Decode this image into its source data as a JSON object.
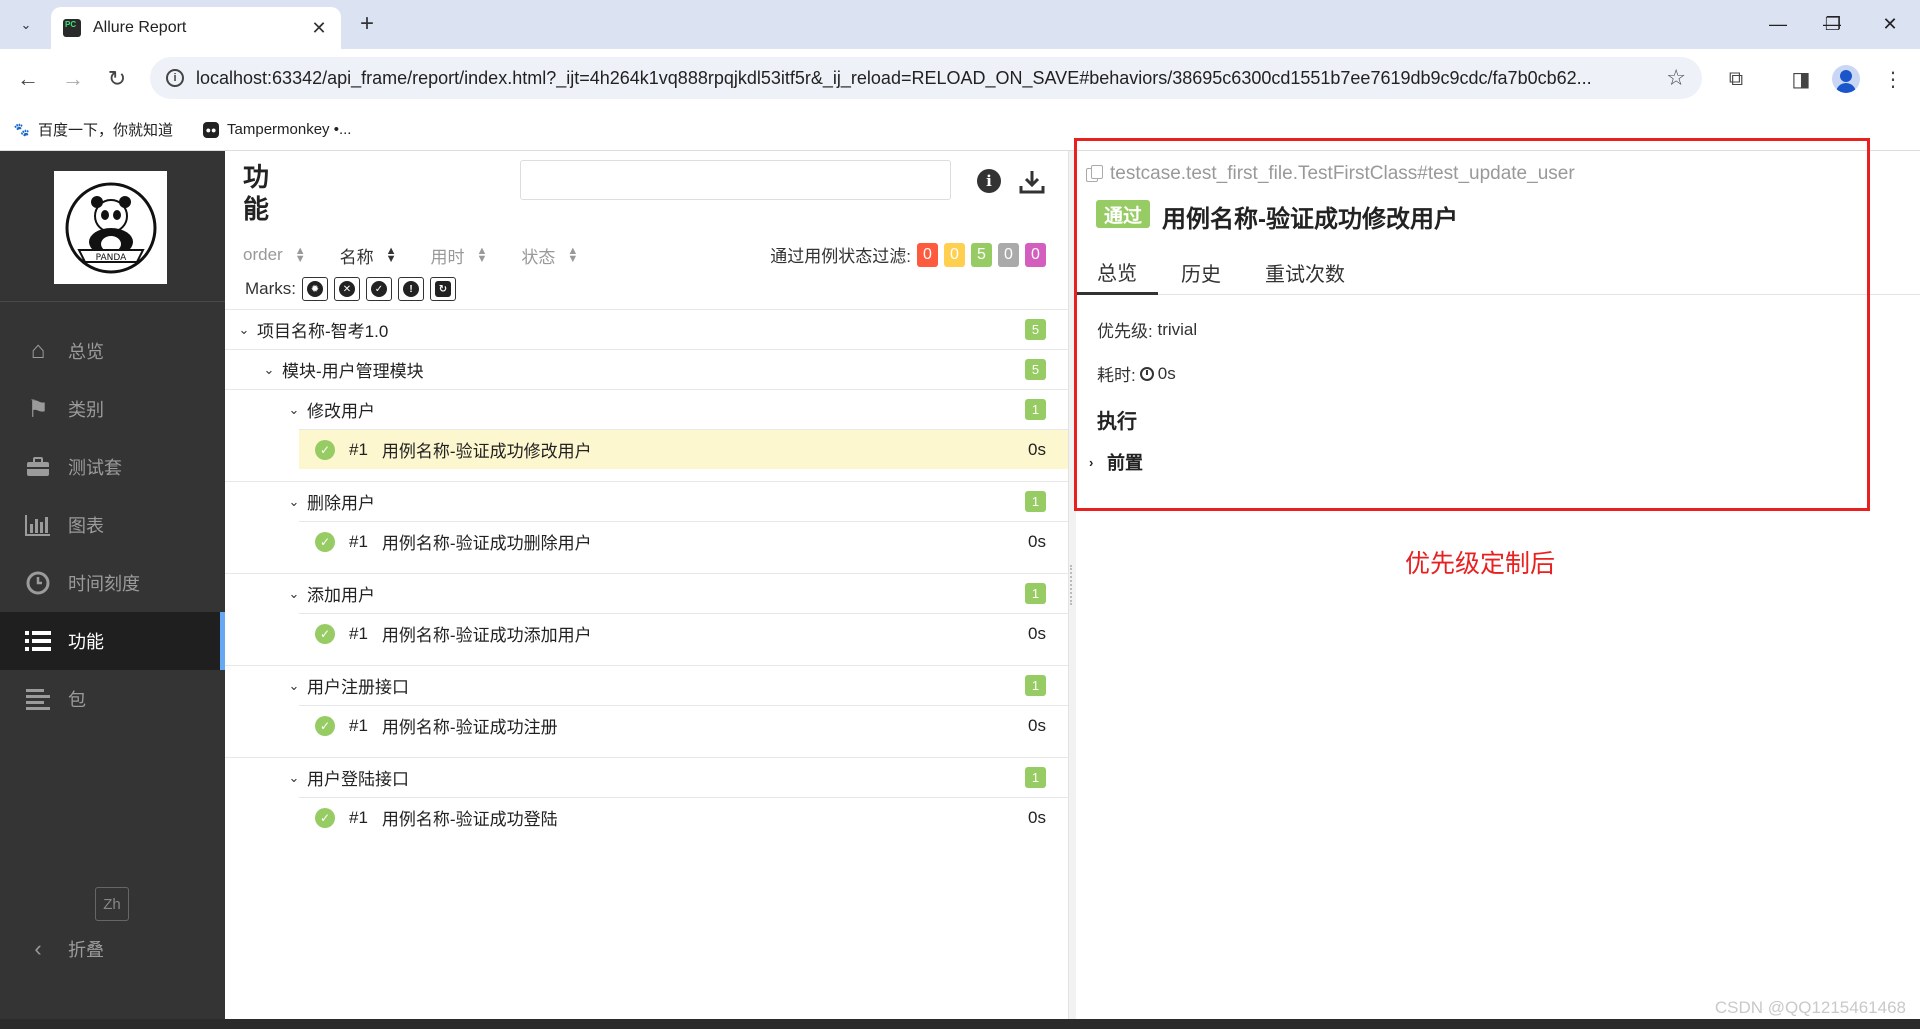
{
  "browser": {
    "tab_title": "Allure Report",
    "url": "localhost:63342/api_frame/report/index.html?_ijt=4h264k1vq888rpqjkdl53itf5r&_ij_reload=RELOAD_ON_SAVE#behaviors/38695c6300cd1551b7ee7619db9c9cdc/fa7b0cb62...",
    "bookmarks": [
      "百度一下，你就知道",
      "Tampermonkey •..."
    ]
  },
  "sidebar": {
    "logo_text": "PANDA",
    "items": [
      {
        "label": "总览",
        "icon": "home-icon"
      },
      {
        "label": "类别",
        "icon": "flag-icon"
      },
      {
        "label": "测试套",
        "icon": "briefcase-icon"
      },
      {
        "label": "图表",
        "icon": "bar-chart-icon"
      },
      {
        "label": "时间刻度",
        "icon": "clock-icon"
      },
      {
        "label": "功能",
        "icon": "list-icon"
      },
      {
        "label": "包",
        "icon": "align-left-icon"
      }
    ],
    "active_index": 5,
    "lang": "Zh",
    "collapse_label": "折叠"
  },
  "tree_pane": {
    "title": "功能",
    "sort_columns": [
      "order",
      "名称",
      "用时",
      "状态"
    ],
    "active_sort": "名称",
    "filter_label": "通过用例状态过滤:",
    "filter_counts": [
      {
        "value": "0",
        "color": "#fd5a3e"
      },
      {
        "value": "0",
        "color": "#ffd050"
      },
      {
        "value": "5",
        "color": "#97cc64"
      },
      {
        "value": "0",
        "color": "#aaaaaa"
      },
      {
        "value": "0",
        "color": "#d35ebe"
      }
    ],
    "marks_label": "Marks:",
    "epic": {
      "name": "项目名称-智考1.0",
      "count": "5"
    },
    "feature": {
      "name": "模块-用户管理模块",
      "count": "5"
    },
    "stories": [
      {
        "name": "修改用户",
        "count": "1",
        "test": {
          "num": "#1",
          "name": "用例名称-验证成功修改用户",
          "duration": "0s"
        }
      },
      {
        "name": "删除用户",
        "count": "1",
        "test": {
          "num": "#1",
          "name": "用例名称-验证成功删除用户",
          "duration": "0s"
        }
      },
      {
        "name": "添加用户",
        "count": "1",
        "test": {
          "num": "#1",
          "name": "用例名称-验证成功添加用户",
          "duration": "0s"
        }
      },
      {
        "name": "用户注册接口",
        "count": "1",
        "test": {
          "num": "#1",
          "name": "用例名称-验证成功注册",
          "duration": "0s"
        }
      },
      {
        "name": "用户登陆接口",
        "count": "1",
        "test": {
          "num": "#1",
          "name": "用例名称-验证成功登陆",
          "duration": "0s"
        }
      }
    ]
  },
  "result": {
    "full_name": "testcase.test_first_file.TestFirstClass#test_update_user",
    "status": "通过",
    "title": "用例名称-验证成功修改用户",
    "tabs": [
      "总览",
      "历史",
      "重试次数"
    ],
    "severity_label": "优先级:",
    "severity_value": "trivial",
    "duration_label": "耗时:",
    "duration_value": "0s",
    "execution_title": "执行",
    "setup_label": "前置"
  },
  "annotation": "优先级定制后",
  "watermark": "CSDN @QQ1215461468"
}
